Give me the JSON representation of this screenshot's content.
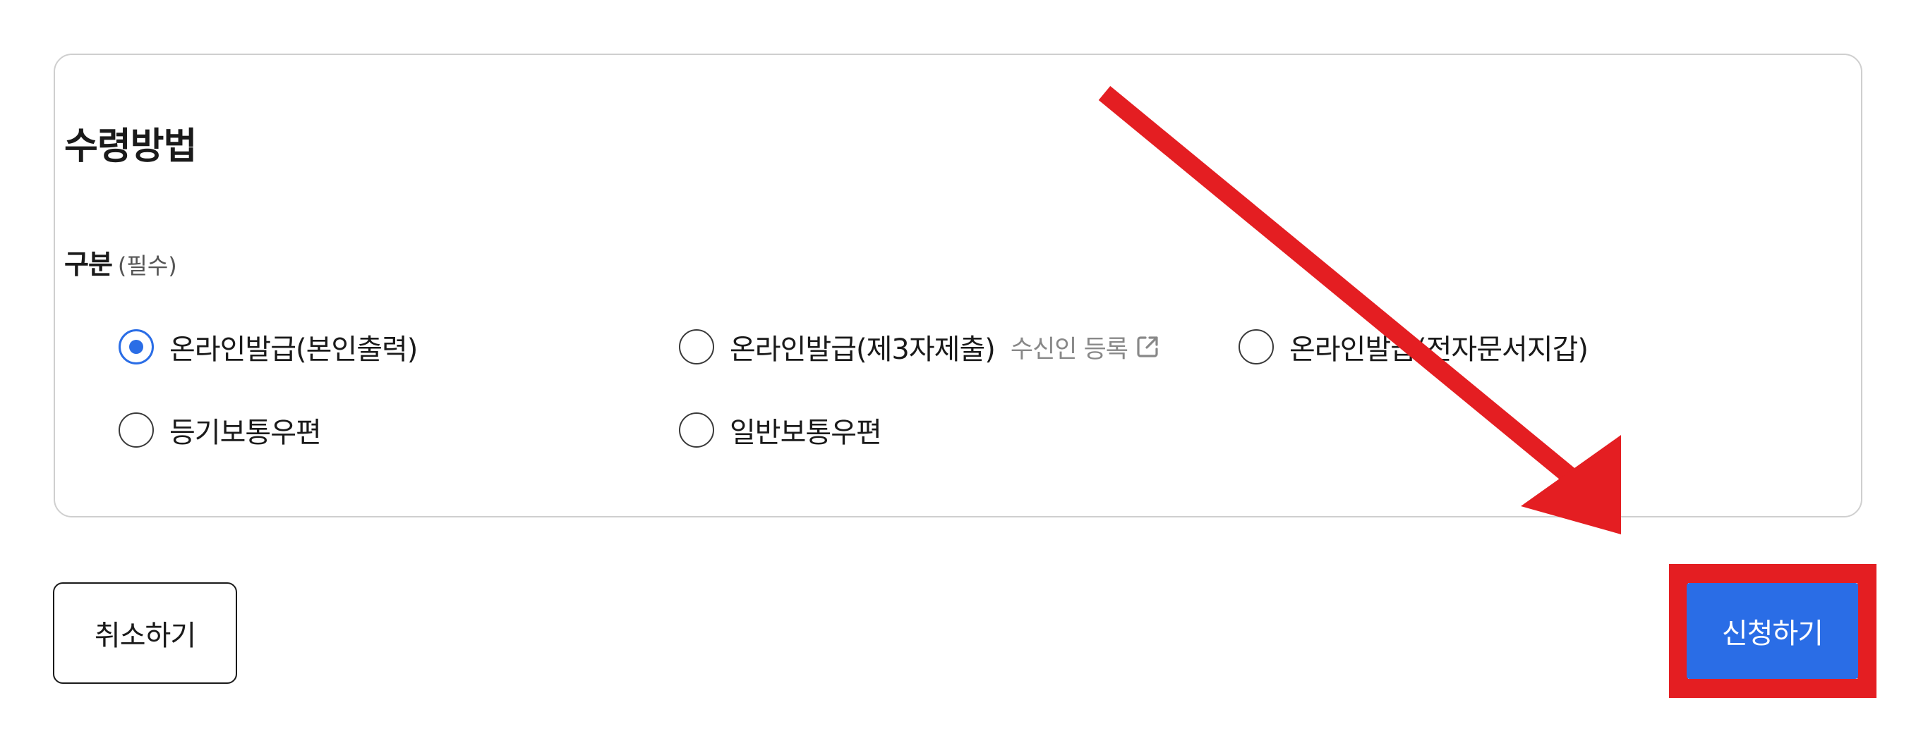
{
  "receipt": {
    "title": "수령방법",
    "field_label": "구분",
    "required_text": "(필수)",
    "options": [
      {
        "label": "온라인발급(본인출력)",
        "checked": true
      },
      {
        "label": "온라인발급(제3자제출)",
        "checked": false
      },
      {
        "label": "온라인발급(전자문서지갑)",
        "checked": false
      },
      {
        "label": "등기보통우편",
        "checked": false
      },
      {
        "label": "일반보통우편",
        "checked": false
      }
    ],
    "register_link": "수신인 등록",
    "register_link_icon": "external-link-icon"
  },
  "actions": {
    "cancel_label": "취소하기",
    "submit_label": "신청하기"
  },
  "annotation": {
    "color": "#e41e22",
    "shape": "arrow-and-box"
  },
  "colors": {
    "accent": "#2a6de6",
    "annotation": "#e41e22",
    "border": "#cfcfcf"
  }
}
